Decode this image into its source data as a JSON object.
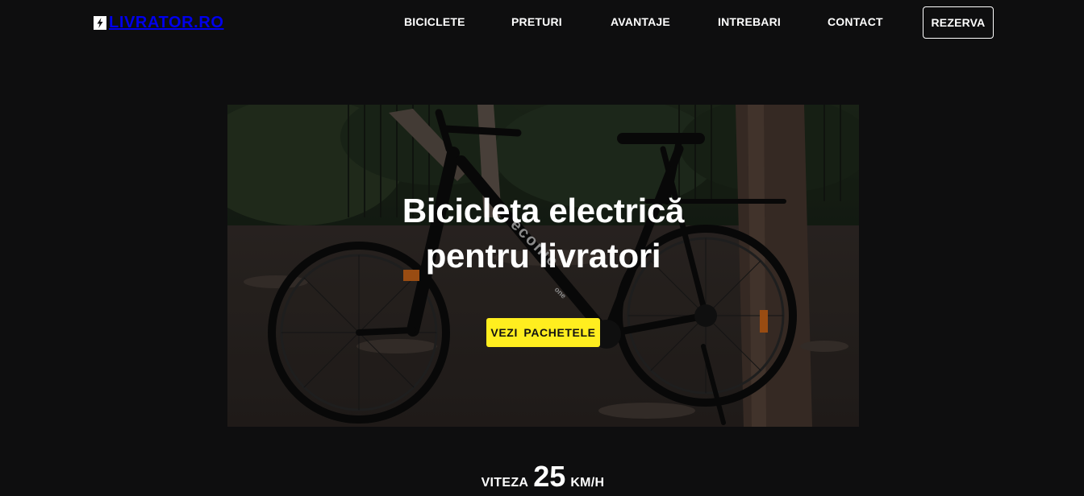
{
  "brand": {
    "logo_text": "LIVRATOR.RO",
    "logo_icon": "bolt-icon"
  },
  "nav": {
    "items": [
      {
        "label": "BICICLETE"
      },
      {
        "label": "PRETURI"
      },
      {
        "label": "AVANTAJE"
      },
      {
        "label": "INTREBARI"
      },
      {
        "label": "CONTACT"
      }
    ],
    "cta_label": "REZERVA"
  },
  "hero": {
    "title_line1": "Bicicleta electrică",
    "title_line2": "pentru livratori",
    "button_label": "VEZI PACHETELE",
    "image": "electric-bike-photo",
    "bike_brand": "econic",
    "bike_model": "one"
  },
  "stat": {
    "label": "VITEZA",
    "value": "25",
    "unit": "KM/H"
  },
  "colors": {
    "background": "#0e0e0f",
    "text": "#ffffff",
    "accent": "#ffee1f"
  }
}
